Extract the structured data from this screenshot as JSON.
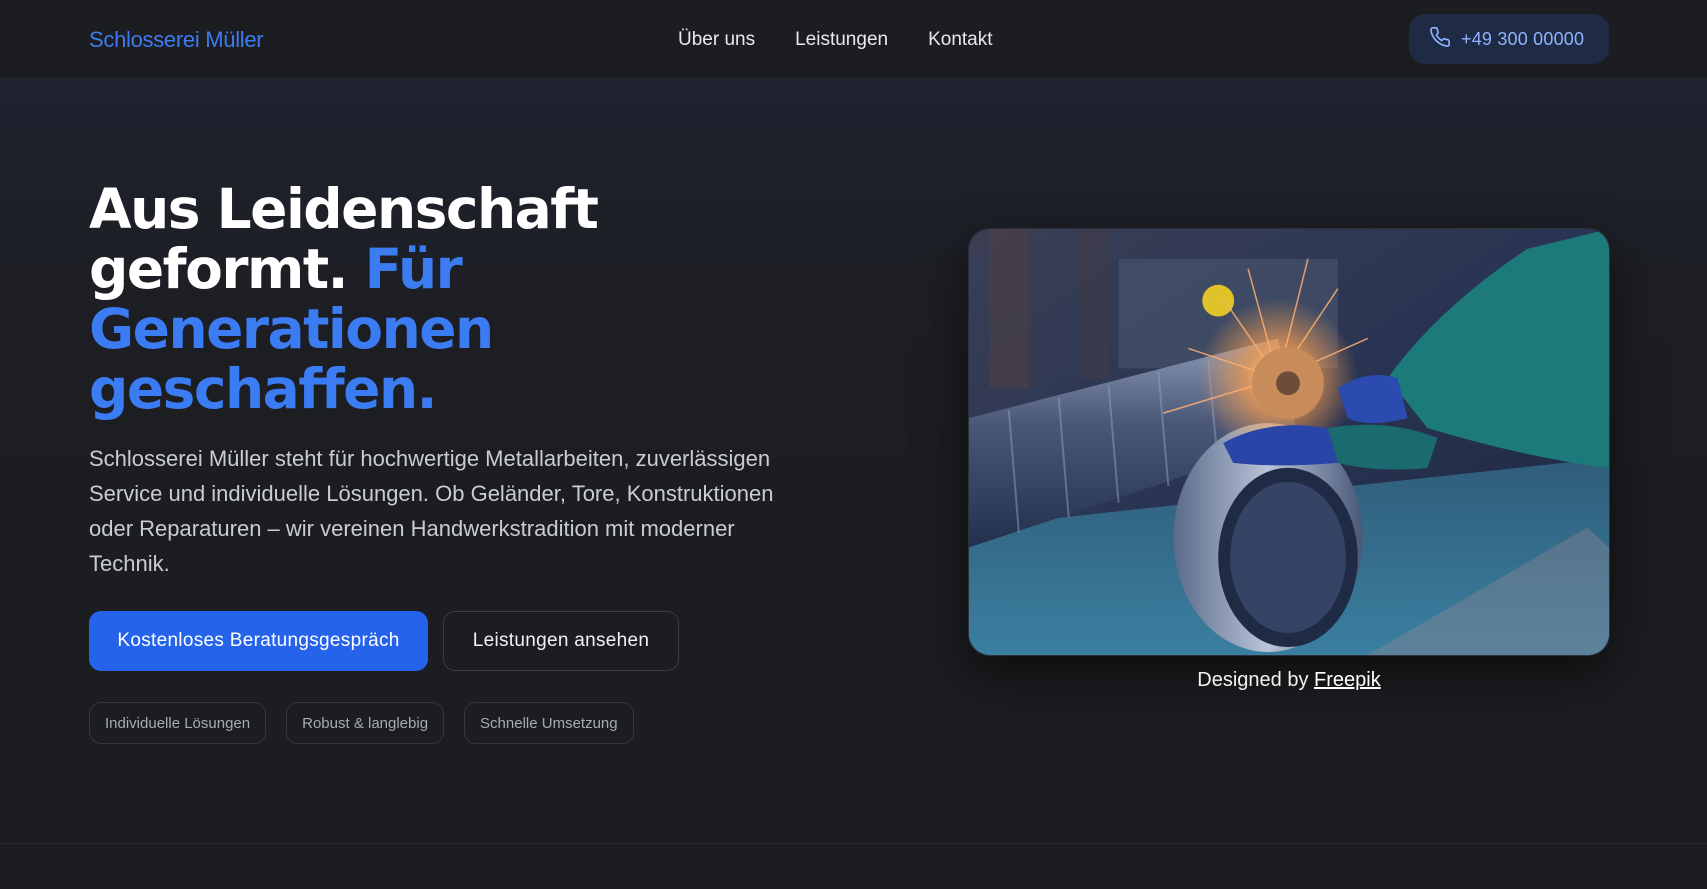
{
  "header": {
    "brand": "Schlosserei Müller",
    "nav": [
      "Über uns",
      "Leistungen",
      "Kontakt"
    ],
    "phone": "+49 300 00000",
    "phone_icon": "phone-icon"
  },
  "hero": {
    "headline_white": "Aus Leidenschaft geformt.",
    "headline_accent": "Für Generationen geschaffen.",
    "lead": "Schlosserei Müller steht für hochwertige Metallarbeiten, zuverlässigen Service und individuelle Lösungen. Ob Geländer, Tore, Konstruktionen oder Reparaturen – wir vereinen Handwerkstradition mit moderner Technik.",
    "cta_primary": "Kostenloses Beratungsgespräch",
    "cta_secondary": "Leistungen ansehen",
    "tags": [
      "Individuelle Lösungen",
      "Robust & langlebig",
      "Schnelle Umsetzung"
    ]
  },
  "image": {
    "credit_prefix": "Designed by",
    "credit_link": "Freepik"
  },
  "colors": {
    "accent": "#3b7cf2",
    "primary_button": "#2563eb",
    "background": "#1c1d20"
  }
}
